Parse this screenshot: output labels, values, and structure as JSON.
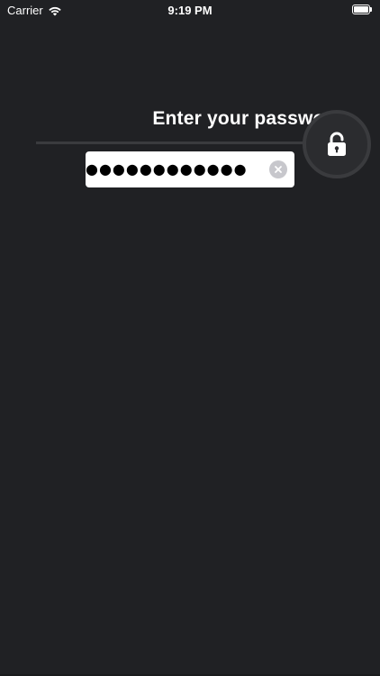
{
  "status_bar": {
    "carrier": "Carrier",
    "time": "9:19 PM",
    "battery_level": 1.0,
    "wifi_icon": "wifi-icon",
    "battery_icon": "battery-icon"
  },
  "login": {
    "prompt": "Enter your password",
    "password_masked": "●●●●●●●●●●●●",
    "lock_icon": "lock-icon",
    "clear_icon": "clear-icon"
  },
  "colors": {
    "background": "#202124",
    "field_background": "#ffffff",
    "lock_ring": "#3a3b3e",
    "clear_button": "#c7c7cc"
  }
}
